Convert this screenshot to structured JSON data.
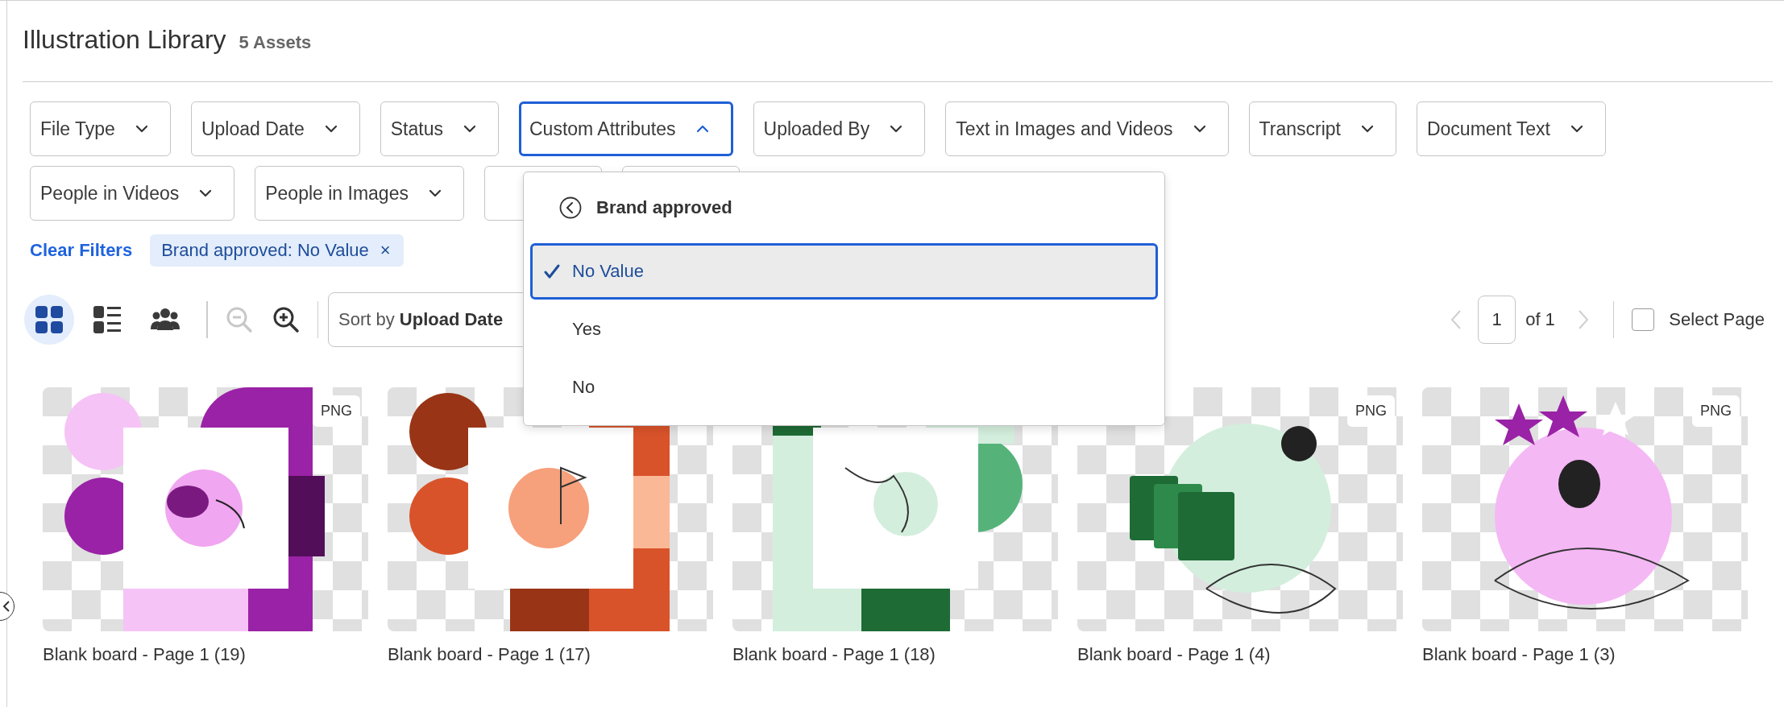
{
  "header": {
    "title": "Illustration Library",
    "count": "5 Assets"
  },
  "filters": [
    {
      "kind": "dropdown",
      "label": "File Type",
      "expanded": false
    },
    {
      "kind": "dropdown",
      "label": "Upload Date",
      "expanded": false
    },
    {
      "kind": "dropdown",
      "label": "Status",
      "expanded": false
    },
    {
      "kind": "dropdown",
      "label": "Custom Attributes",
      "expanded": true
    },
    {
      "kind": "dropdown",
      "label": "Uploaded By",
      "expanded": false
    },
    {
      "kind": "dropdown",
      "label": "Text in Images and Videos",
      "expanded": false
    },
    {
      "kind": "dropdown",
      "label": "Transcript",
      "expanded": false
    },
    {
      "kind": "dropdown",
      "label": "Document Text",
      "expanded": false
    },
    {
      "kind": "dropdown",
      "label": "People in Videos",
      "expanded": false
    },
    {
      "kind": "dropdown",
      "label": "People in Images",
      "expanded": false
    },
    {
      "kind": "covered"
    },
    {
      "kind": "covered"
    }
  ],
  "clear_filters": "Clear Filters",
  "active_filters": [
    {
      "label": "Brand approved: No Value",
      "remove": "×"
    }
  ],
  "toolbar": {
    "views": [
      {
        "kind": "grid",
        "selected": true
      },
      {
        "kind": "list",
        "selected": false
      },
      {
        "kind": "people",
        "selected": false
      }
    ],
    "zoom_out": {
      "disabled": true
    },
    "zoom_in": {
      "disabled": false
    },
    "sort": "Sort by **Upload Date**"
  },
  "pagination": {
    "page": "1",
    "total": "of 1",
    "prev_disabled": true,
    "next_disabled": true
  },
  "select_page": {
    "label": "Select Page",
    "checked": false
  },
  "dropdown": {
    "title": "Brand approved",
    "options": [
      {
        "label": "No Value",
        "selected": true
      },
      {
        "label": "Yes",
        "selected": false
      },
      {
        "label": "No",
        "selected": false
      }
    ]
  },
  "assets": [
    {
      "name": "Blank board - Page 1 (19)",
      "badge": "PNG",
      "kind": "picture"
    },
    {
      "name": "Blank board - Page 1 (17)",
      "kind": "picture"
    },
    {
      "name": "Blank board - Page 1 (18)",
      "kind": "picture"
    },
    {
      "name": "Blank board - Page 1 (4)",
      "badge": "PNG",
      "kind": "picture"
    },
    {
      "name": "Blank board - Page 1 (3)",
      "badge": "PNG",
      "kind": "picture"
    }
  ]
}
